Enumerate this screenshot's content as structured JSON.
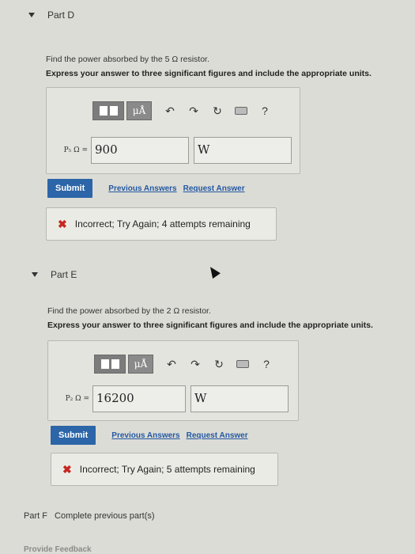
{
  "partD": {
    "title": "Part D",
    "prompt": "Find the power absorbed by the 5 Ω resistor.",
    "instructions": "Express your answer to three significant figures and include the appropriate units.",
    "variable_label": "P₅ Ω =",
    "value": "900",
    "unit": "W",
    "submit_label": "Submit",
    "previous_answers_label": "Previous Answers",
    "request_answer_label": "Request Answer",
    "feedback": "Incorrect; Try Again; 4 attempts remaining"
  },
  "partE": {
    "title": "Part E",
    "prompt": "Find the power absorbed by the 2 Ω resistor.",
    "instructions": "Express your answer to three significant figures and include the appropriate units.",
    "variable_label": "P₂ Ω =",
    "value": "16200",
    "unit": "W",
    "submit_label": "Submit",
    "previous_answers_label": "Previous Answers",
    "request_answer_label": "Request Answer",
    "feedback": "Incorrect; Try Again; 5 attempts remaining"
  },
  "toolbar": {
    "units_label": "μÅ",
    "help_label": "?",
    "undo_glyph": "↶",
    "redo_glyph": "↷",
    "reset_glyph": "↻",
    "feedback_mark": "✖"
  },
  "partF": {
    "title": "Part F",
    "text": "Complete previous part(s)"
  },
  "footer": {
    "provide_feedback": "Provide Feedback"
  }
}
